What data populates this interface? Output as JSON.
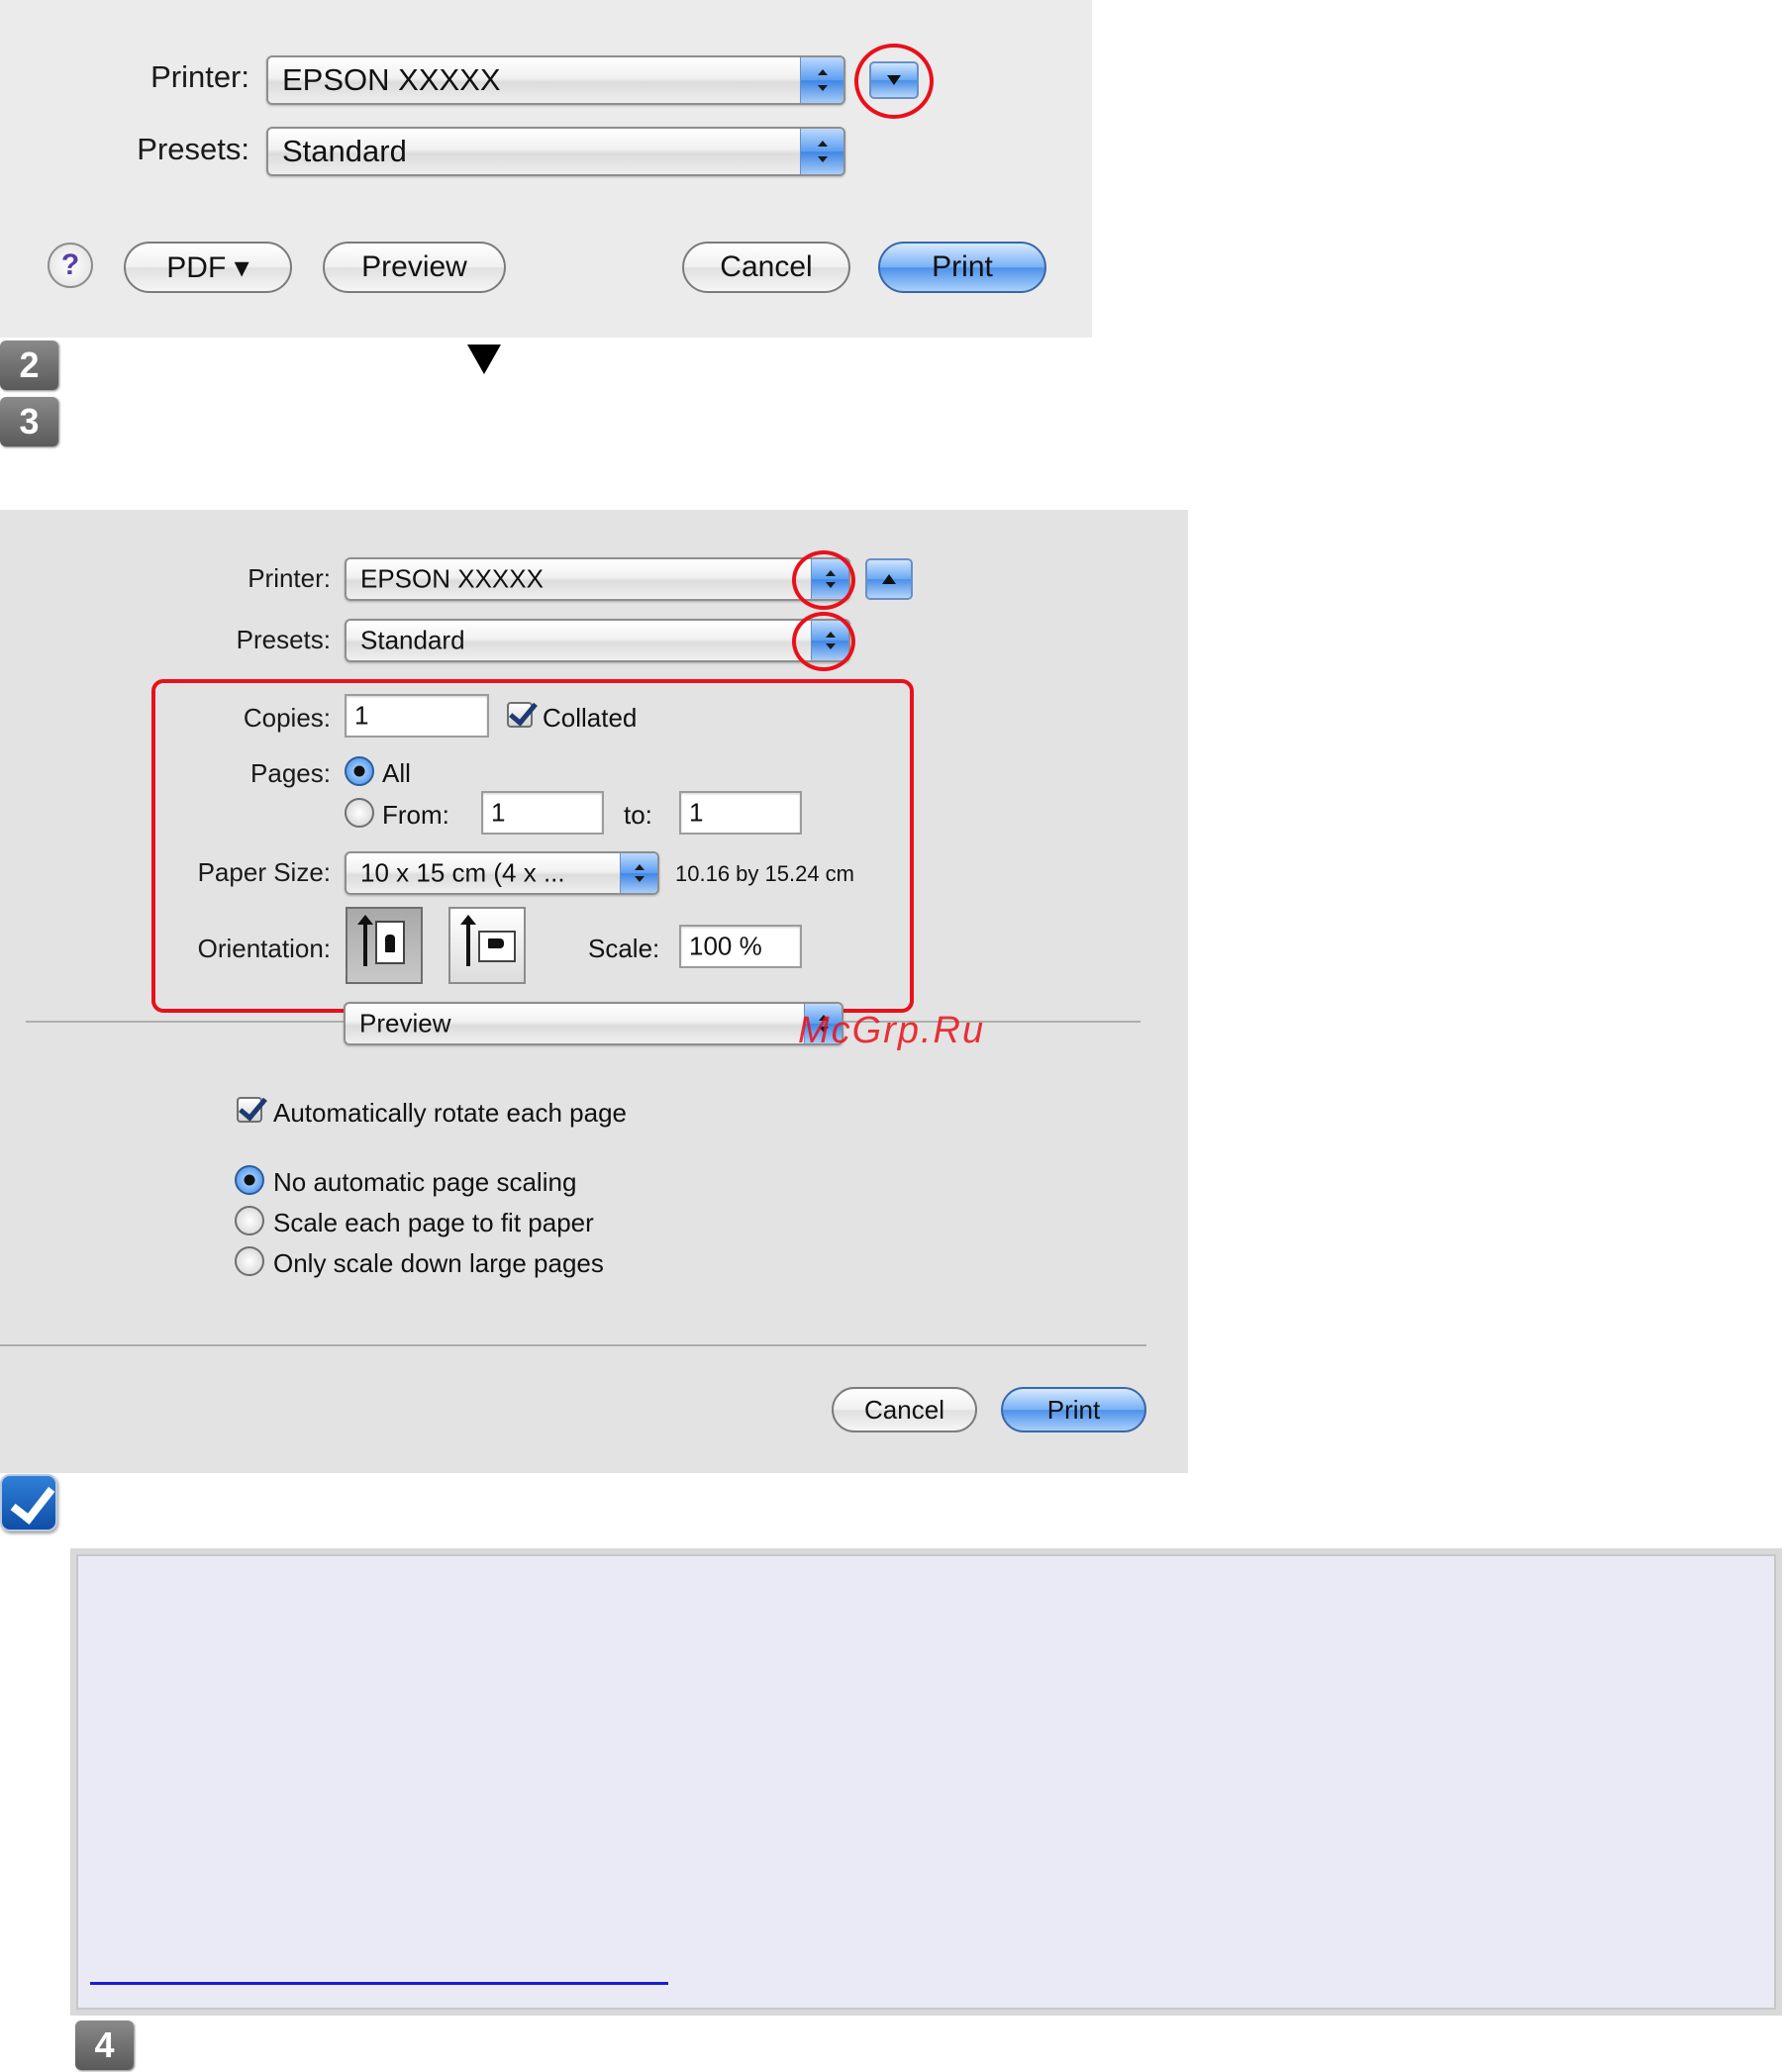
{
  "dialog1": {
    "printer_label": "Printer:",
    "printer_value": "EPSON XXXXX",
    "presets_label": "Presets:",
    "presets_value": "Standard",
    "help_label": "?",
    "pdf_label": "PDF ▾",
    "preview_label": "Preview",
    "cancel_label": "Cancel",
    "print_label": "Print"
  },
  "steps": {
    "step2": "2",
    "step3": "3",
    "step4": "4"
  },
  "dialog2": {
    "printer_label": "Printer:",
    "printer_value": "EPSON XXXXX",
    "presets_label": "Presets:",
    "presets_value": "Standard",
    "copies_label": "Copies:",
    "copies_value": "1",
    "collated_label": "Collated",
    "collated_checked": true,
    "pages_label": "Pages:",
    "pages_all_label": "All",
    "pages_from_label": "From:",
    "pages_from_value": "1",
    "pages_to_label": "to:",
    "pages_to_value": "1",
    "paper_size_label": "Paper Size:",
    "paper_size_value": "10 x 15 cm (4 x ...",
    "paper_size_dims": "10.16 by 15.24 cm",
    "orientation_label": "Orientation:",
    "scale_label": "Scale:",
    "scale_value": "100 %",
    "section_popup_value": "Preview",
    "auto_rotate_label": "Automatically rotate each page",
    "auto_rotate_checked": true,
    "scaling_options": [
      "No automatic page scaling",
      "Scale each page to fit paper",
      "Only scale down large pages"
    ],
    "scaling_selected": 0,
    "cancel_label": "Cancel",
    "print_label": "Print"
  },
  "watermark": "McGrp.Ru",
  "colors": {
    "annotation_red": "#e8111b",
    "accent_blue": "#4d92ea",
    "note_bg": "#eaeaf7",
    "link_blue": "#1a1ad6"
  }
}
